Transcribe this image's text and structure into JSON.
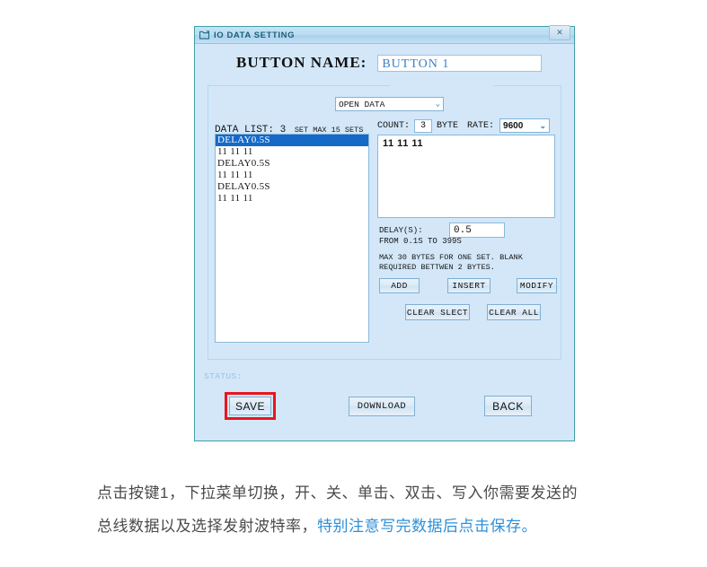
{
  "window": {
    "title": "IO DATA SETTING",
    "title_icon": "window-folder-icon",
    "close_label": "✕",
    "border_color": "#3f9fa8",
    "background_color": "#d3e7f9"
  },
  "button_name": {
    "label": "BUTTON NAME:",
    "value": "BUTTON 1",
    "placeholder": ""
  },
  "mode": {
    "selected": "OPEN DATA",
    "caret": "⌄"
  },
  "data_list": {
    "header_big": "DATA LIST: 3",
    "header_small": "SET  MAX 15 SETS",
    "items": [
      {
        "text": "DELAY0.5S",
        "selected": true
      },
      {
        "text": "11 11 11",
        "selected": false
      },
      {
        "text": "DELAY0.5S",
        "selected": false
      },
      {
        "text": "11 11 11",
        "selected": false
      },
      {
        "text": "DELAY0.5S",
        "selected": false
      },
      {
        "text": "11 11 11",
        "selected": false
      }
    ],
    "selection_color": "#1569c7"
  },
  "count": {
    "label": "COUNT:",
    "value": "3",
    "unit": "BYTE"
  },
  "rate": {
    "label": "RATE:",
    "selected": "9600",
    "caret": "⌄"
  },
  "data_text": {
    "value": "11 11 11"
  },
  "delay": {
    "line1": "DELAY(S):",
    "line2": "FROM 0.1S TO 399S",
    "value": "0.5"
  },
  "hint": {
    "line1": "MAX 30 BYTES FOR ONE SET. BLANK",
    "line2": "REQUIRED BETTWEN 2 BYTES."
  },
  "actions": {
    "add": "ADD",
    "insert": "INSERT",
    "modify": "MODIFY",
    "clear_select": "CLEAR SLECT",
    "clear_all": "CLEAR ALL"
  },
  "status": {
    "label": "STATUS:"
  },
  "footer": {
    "save": "SAVE",
    "download": "DOWNLOAD",
    "back": "BACK",
    "save_highlight_color": "#e8171c"
  },
  "caption": {
    "line1": "点击按键1，下拉菜单切换，开、关、单击、双击、写入你需要发送的",
    "line2_normal": "总线数据以及选择发射波特率，",
    "line2_highlight": "特别注意写完数据后点击保存。",
    "highlight_color": "#2f8fd8"
  }
}
